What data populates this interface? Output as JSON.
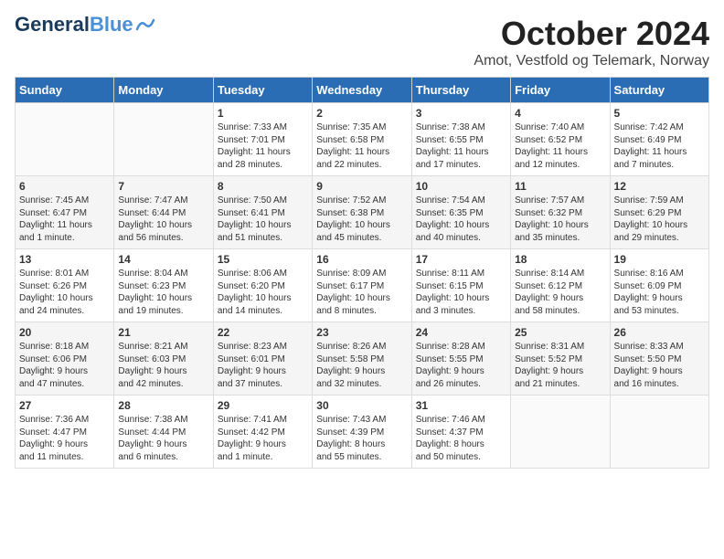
{
  "logo": {
    "general": "General",
    "blue": "Blue"
  },
  "header": {
    "month": "October 2024",
    "location": "Amot, Vestfold og Telemark, Norway"
  },
  "weekdays": [
    "Sunday",
    "Monday",
    "Tuesday",
    "Wednesday",
    "Thursday",
    "Friday",
    "Saturday"
  ],
  "weeks": [
    [
      {
        "day": "",
        "info": ""
      },
      {
        "day": "",
        "info": ""
      },
      {
        "day": "1",
        "info": "Sunrise: 7:33 AM\nSunset: 7:01 PM\nDaylight: 11 hours\nand 28 minutes."
      },
      {
        "day": "2",
        "info": "Sunrise: 7:35 AM\nSunset: 6:58 PM\nDaylight: 11 hours\nand 22 minutes."
      },
      {
        "day": "3",
        "info": "Sunrise: 7:38 AM\nSunset: 6:55 PM\nDaylight: 11 hours\nand 17 minutes."
      },
      {
        "day": "4",
        "info": "Sunrise: 7:40 AM\nSunset: 6:52 PM\nDaylight: 11 hours\nand 12 minutes."
      },
      {
        "day": "5",
        "info": "Sunrise: 7:42 AM\nSunset: 6:49 PM\nDaylight: 11 hours\nand 7 minutes."
      }
    ],
    [
      {
        "day": "6",
        "info": "Sunrise: 7:45 AM\nSunset: 6:47 PM\nDaylight: 11 hours\nand 1 minute."
      },
      {
        "day": "7",
        "info": "Sunrise: 7:47 AM\nSunset: 6:44 PM\nDaylight: 10 hours\nand 56 minutes."
      },
      {
        "day": "8",
        "info": "Sunrise: 7:50 AM\nSunset: 6:41 PM\nDaylight: 10 hours\nand 51 minutes."
      },
      {
        "day": "9",
        "info": "Sunrise: 7:52 AM\nSunset: 6:38 PM\nDaylight: 10 hours\nand 45 minutes."
      },
      {
        "day": "10",
        "info": "Sunrise: 7:54 AM\nSunset: 6:35 PM\nDaylight: 10 hours\nand 40 minutes."
      },
      {
        "day": "11",
        "info": "Sunrise: 7:57 AM\nSunset: 6:32 PM\nDaylight: 10 hours\nand 35 minutes."
      },
      {
        "day": "12",
        "info": "Sunrise: 7:59 AM\nSunset: 6:29 PM\nDaylight: 10 hours\nand 29 minutes."
      }
    ],
    [
      {
        "day": "13",
        "info": "Sunrise: 8:01 AM\nSunset: 6:26 PM\nDaylight: 10 hours\nand 24 minutes."
      },
      {
        "day": "14",
        "info": "Sunrise: 8:04 AM\nSunset: 6:23 PM\nDaylight: 10 hours\nand 19 minutes."
      },
      {
        "day": "15",
        "info": "Sunrise: 8:06 AM\nSunset: 6:20 PM\nDaylight: 10 hours\nand 14 minutes."
      },
      {
        "day": "16",
        "info": "Sunrise: 8:09 AM\nSunset: 6:17 PM\nDaylight: 10 hours\nand 8 minutes."
      },
      {
        "day": "17",
        "info": "Sunrise: 8:11 AM\nSunset: 6:15 PM\nDaylight: 10 hours\nand 3 minutes."
      },
      {
        "day": "18",
        "info": "Sunrise: 8:14 AM\nSunset: 6:12 PM\nDaylight: 9 hours\nand 58 minutes."
      },
      {
        "day": "19",
        "info": "Sunrise: 8:16 AM\nSunset: 6:09 PM\nDaylight: 9 hours\nand 53 minutes."
      }
    ],
    [
      {
        "day": "20",
        "info": "Sunrise: 8:18 AM\nSunset: 6:06 PM\nDaylight: 9 hours\nand 47 minutes."
      },
      {
        "day": "21",
        "info": "Sunrise: 8:21 AM\nSunset: 6:03 PM\nDaylight: 9 hours\nand 42 minutes."
      },
      {
        "day": "22",
        "info": "Sunrise: 8:23 AM\nSunset: 6:01 PM\nDaylight: 9 hours\nand 37 minutes."
      },
      {
        "day": "23",
        "info": "Sunrise: 8:26 AM\nSunset: 5:58 PM\nDaylight: 9 hours\nand 32 minutes."
      },
      {
        "day": "24",
        "info": "Sunrise: 8:28 AM\nSunset: 5:55 PM\nDaylight: 9 hours\nand 26 minutes."
      },
      {
        "day": "25",
        "info": "Sunrise: 8:31 AM\nSunset: 5:52 PM\nDaylight: 9 hours\nand 21 minutes."
      },
      {
        "day": "26",
        "info": "Sunrise: 8:33 AM\nSunset: 5:50 PM\nDaylight: 9 hours\nand 16 minutes."
      }
    ],
    [
      {
        "day": "27",
        "info": "Sunrise: 7:36 AM\nSunset: 4:47 PM\nDaylight: 9 hours\nand 11 minutes."
      },
      {
        "day": "28",
        "info": "Sunrise: 7:38 AM\nSunset: 4:44 PM\nDaylight: 9 hours\nand 6 minutes."
      },
      {
        "day": "29",
        "info": "Sunrise: 7:41 AM\nSunset: 4:42 PM\nDaylight: 9 hours\nand 1 minute."
      },
      {
        "day": "30",
        "info": "Sunrise: 7:43 AM\nSunset: 4:39 PM\nDaylight: 8 hours\nand 55 minutes."
      },
      {
        "day": "31",
        "info": "Sunrise: 7:46 AM\nSunset: 4:37 PM\nDaylight: 8 hours\nand 50 minutes."
      },
      {
        "day": "",
        "info": ""
      },
      {
        "day": "",
        "info": ""
      }
    ]
  ]
}
